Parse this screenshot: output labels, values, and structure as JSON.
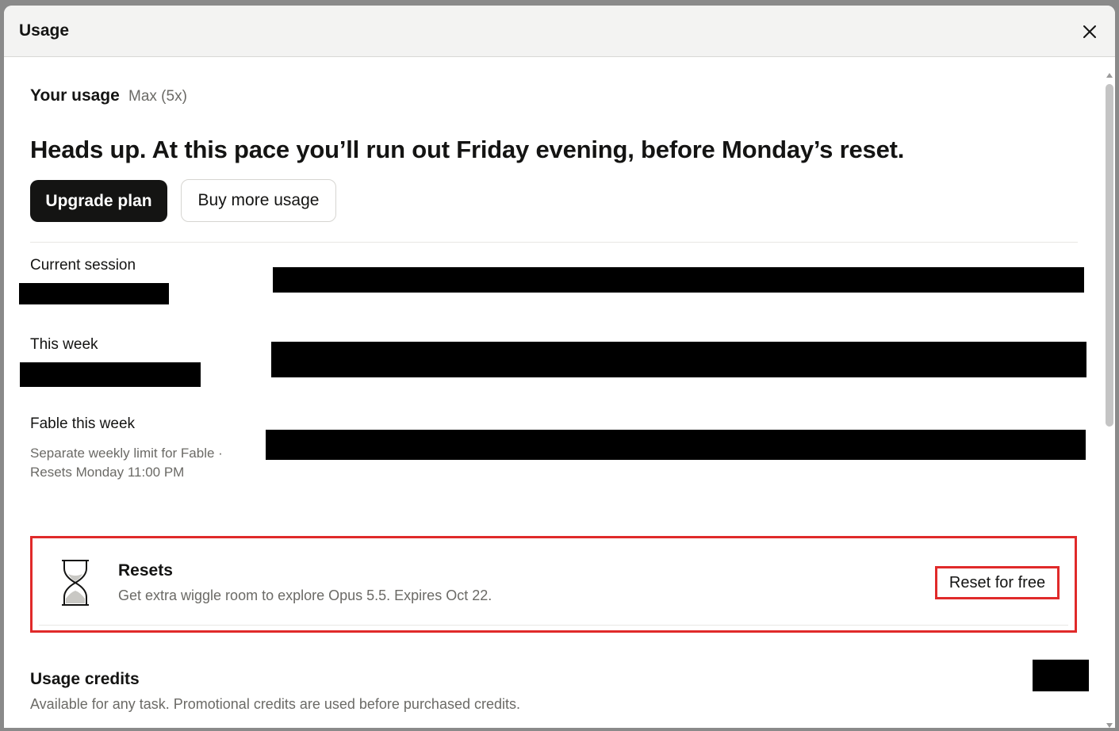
{
  "dialog": {
    "title": "Usage",
    "close_icon": "close-icon"
  },
  "usage": {
    "heading": "Your usage",
    "plan": "Max (5x)",
    "headline": "Heads up. At this pace you’ll run out Friday evening, before Monday’s reset.",
    "upgrade_label": "Upgrade plan",
    "buy_label": "Buy more usage"
  },
  "limits": [
    {
      "label": "Current session"
    },
    {
      "label": "This week"
    },
    {
      "label": "Fable this week",
      "sub_line1": "Separate weekly limit for Fable ·",
      "sub_line2": "Resets Monday 11:00 PM"
    }
  ],
  "resets": {
    "icon": "hourglass-icon",
    "title": "Resets",
    "description": "Get extra wiggle room to explore Opus 5.5. Expires Oct 22.",
    "button_label": "Reset for free",
    "highlight_color": "#e02a2a"
  },
  "credits": {
    "title": "Usage credits",
    "description": "Available for any task. Promotional credits are used before purchased credits."
  }
}
